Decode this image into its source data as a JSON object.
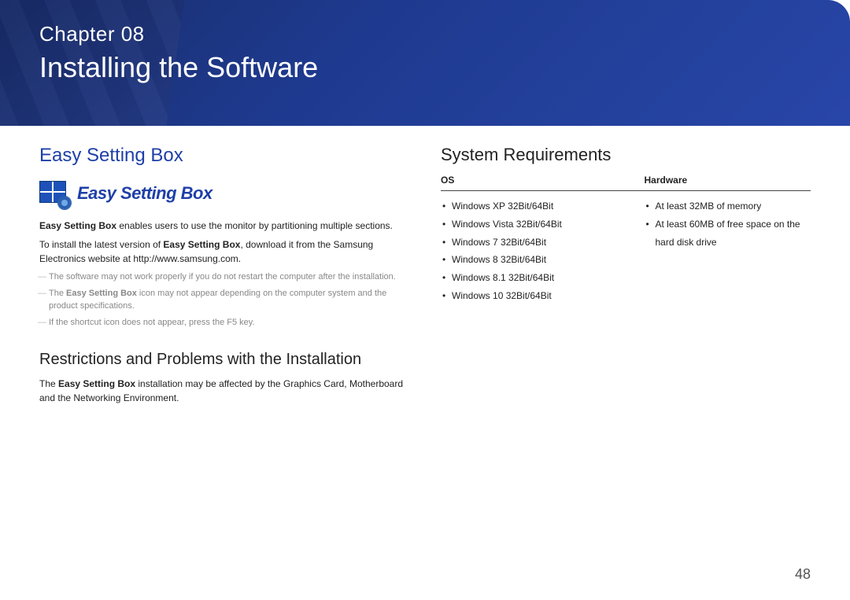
{
  "banner": {
    "chapter": "Chapter 08",
    "title": "Installing the Software"
  },
  "left": {
    "heading": "Easy Setting Box",
    "logo_text": "Easy Setting Box",
    "p1_strong": "Easy Setting Box",
    "p1_rest": " enables users to use the monitor by partitioning multiple sections.",
    "p2_a": "To install the latest version of ",
    "p2_strong": "Easy Setting Box",
    "p2_b": ", download it from the Samsung Electronics website at http://www.samsung.com.",
    "note1": "The software may not work properly if you do not restart the computer after the installation.",
    "note2_a": "The ",
    "note2_strong": "Easy Setting Box",
    "note2_b": " icon may not appear depending on the computer system and the product specifications.",
    "note3": "If the shortcut icon does not appear, press the F5 key.",
    "sub_heading": "Restrictions and Problems with the Installation",
    "sub_p_a": "The ",
    "sub_p_strong": "Easy Setting Box",
    "sub_p_b": " installation may be affected by the Graphics Card, Motherboard and the Networking Environment."
  },
  "right": {
    "heading": "System Requirements",
    "col1_header": "OS",
    "col2_header": "Hardware",
    "os_list": [
      "Windows XP 32Bit/64Bit",
      "Windows Vista 32Bit/64Bit",
      "Windows 7 32Bit/64Bit",
      "Windows 8 32Bit/64Bit",
      "Windows 8.1 32Bit/64Bit",
      "Windows 10 32Bit/64Bit"
    ],
    "hw_list": [
      "At least 32MB of memory",
      "At least 60MB of free space on the hard disk drive"
    ]
  },
  "page_number": "48"
}
